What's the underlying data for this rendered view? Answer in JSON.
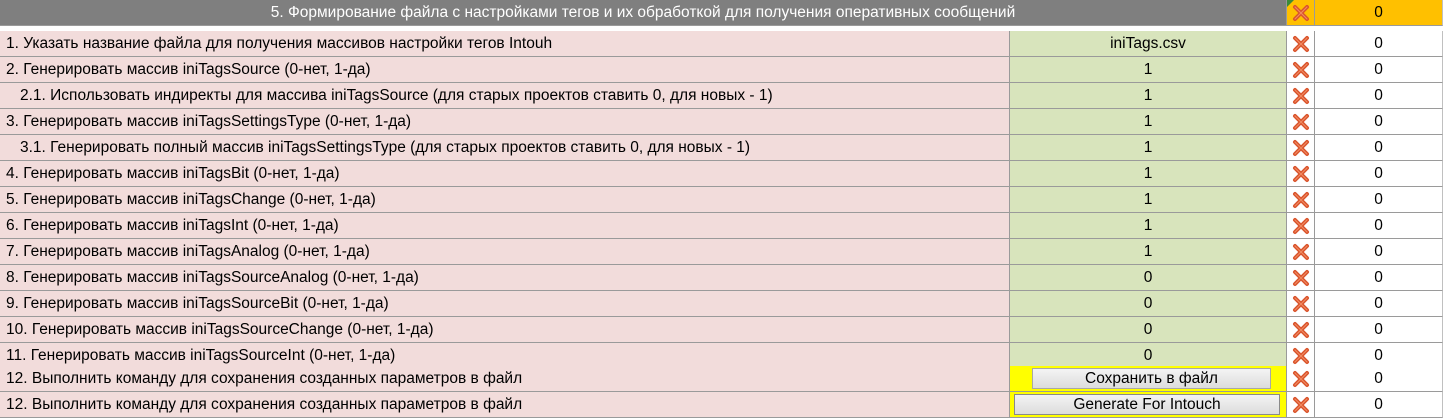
{
  "header": {
    "title": "5. Формирование файла с настройками тегов и их обработкой для получения оперативных сообщений",
    "status": "0"
  },
  "rows": [
    {
      "label": "1. Указать название  файла для получения массивов настройки тегов Intouh",
      "value": "iniTags.csv",
      "status": "0"
    },
    {
      "label": "2. Генерировать  массив  iniTagsSource (0-нет, 1-да)",
      "value": "1",
      "status": "0"
    },
    {
      "label": "2.1. Использовать индиректы для массива iniTagsSource (для старых проектов ставить 0, для новых - 1)",
      "value": "1",
      "status": "0"
    },
    {
      "label": "3. Генерировать  массив  iniTagsSettingsType (0-нет, 1-да)",
      "value": "1",
      "status": "0"
    },
    {
      "label": "3.1. Генерировать  полный массив  iniTagsSettingsType  (для старых проектов ставить 0, для новых - 1)",
      "value": "1",
      "status": "0"
    },
    {
      "label": "4. Генерировать  массив  iniTagsBit (0-нет, 1-да)",
      "value": "1",
      "status": "0"
    },
    {
      "label": "5. Генерировать  массив  iniTagsChange (0-нет, 1-да)",
      "value": "1",
      "status": "0"
    },
    {
      "label": "6. Генерировать  массив  iniTagsInt (0-нет, 1-да)",
      "value": "1",
      "status": "0"
    },
    {
      "label": "7. Генерировать  массив  iniTagsAnalog (0-нет, 1-да)",
      "value": "1",
      "status": "0"
    },
    {
      "label": "8. Генерировать  массив  iniTagsSourceAnalog (0-нет, 1-да)",
      "value": "0",
      "status": "0"
    },
    {
      "label": "9. Генерировать  массив  iniTagsSourceBit (0-нет, 1-да)",
      "value": "0",
      "status": "0"
    },
    {
      "label": "10. Генерировать  массив  iniTagsSourceChange (0-нет, 1-да)",
      "value": "0",
      "status": "0"
    },
    {
      "label": "11. Генерировать  массив  iniTagsSourceInt (0-нет, 1-да)",
      "value": "0",
      "status": "0"
    },
    {
      "label": "12. Выполнить команду для сохранения созданных параметров в файл",
      "button": "Сохранить в файл",
      "status": "0"
    },
    {
      "label": "12. Выполнить команду для сохранения созданных параметров в файл",
      "button": "Generate For Intouch",
      "status": "0"
    }
  ],
  "icons": {
    "status_icon": "red-x-icon"
  },
  "colors": {
    "label_bg": "#f2dcdb",
    "value_bg": "#d8e4bc",
    "header_bg": "#7f7f7f",
    "header_status_bg": "#ffc000",
    "button_cell_bg": "#ffff00",
    "x_icon": "#d9532b"
  }
}
